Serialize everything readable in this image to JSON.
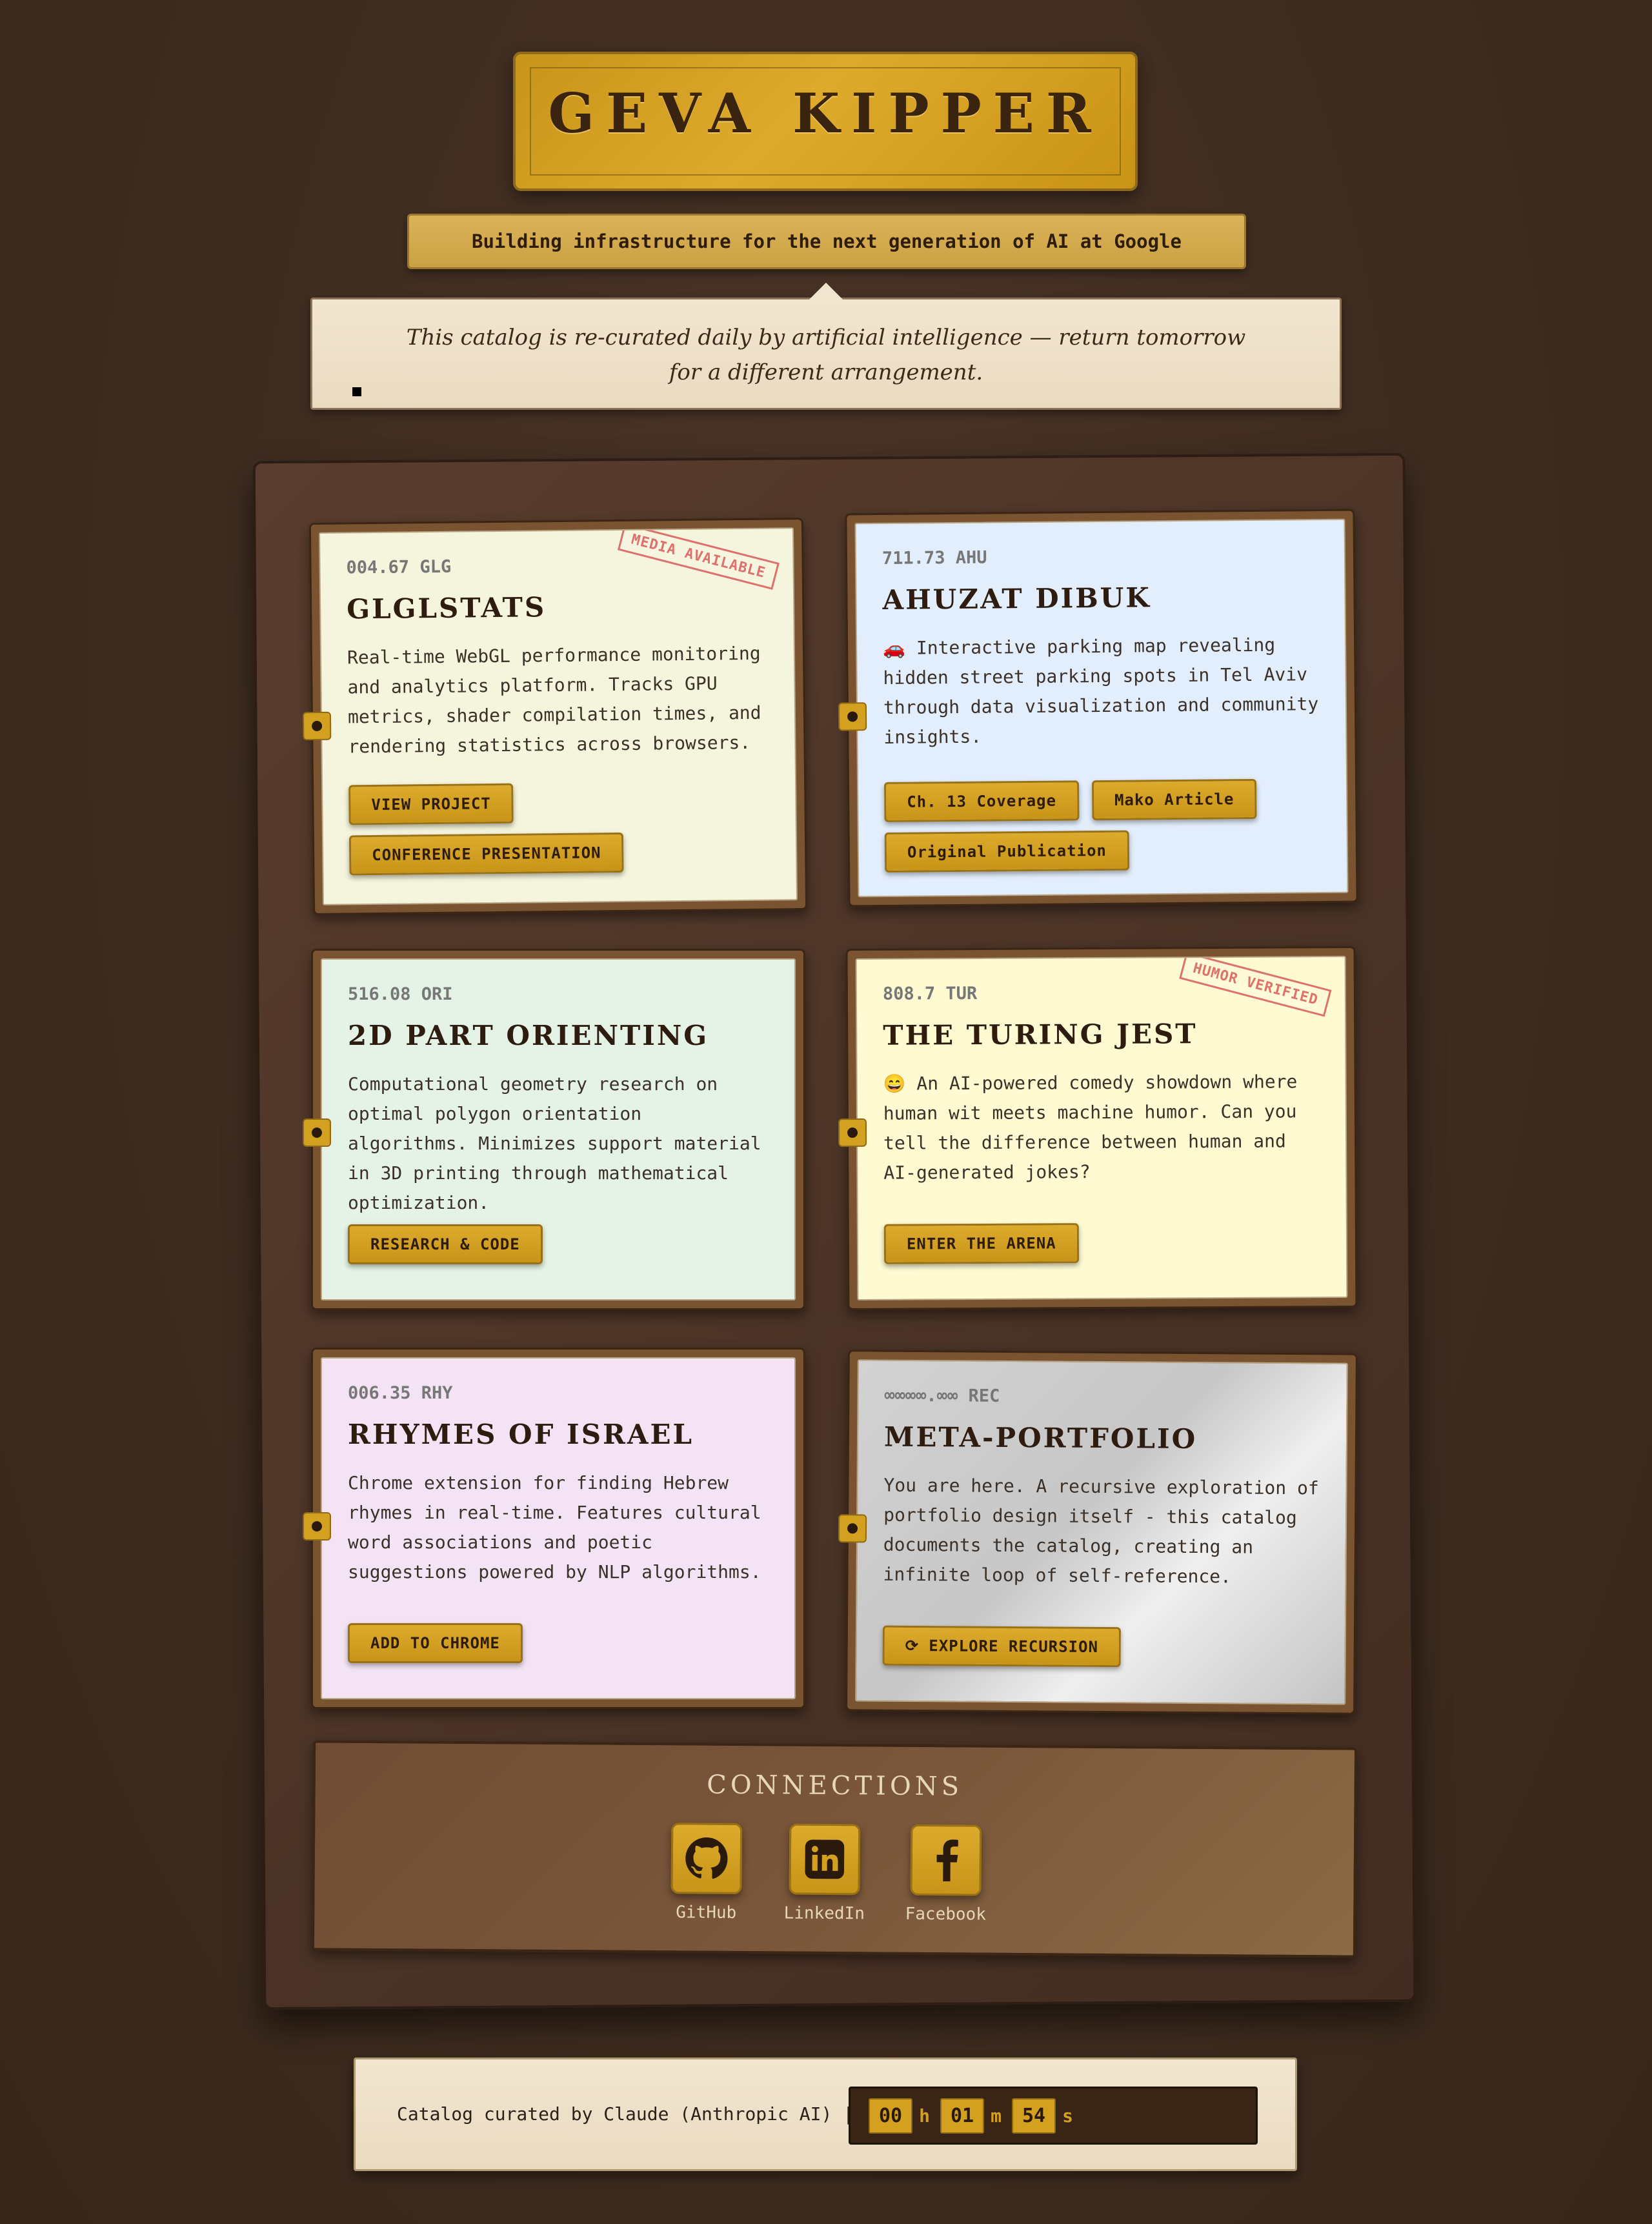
{
  "header": {
    "name": "GEVA KIPPER",
    "tagline": "Building infrastructure for the next generation of AI at Google",
    "notice": "This catalog is re-curated daily by artificial intelligence — return tomorrow for a different arrangement."
  },
  "cards": [
    {
      "code": "004.67 GLG",
      "title": "GLGLSTATS",
      "description": "Real-time WebGL performance monitoring and analytics platform. Tracks GPU metrics, shader compilation times, and rendering statistics across browsers.",
      "stamp": "MEDIA AVAILABLE",
      "buttons": [
        "VIEW PROJECT",
        "CONFERENCE PRESENTATION"
      ],
      "color": "#f5f4dc"
    },
    {
      "code": "711.73 AHU",
      "title": "AHUZAT DIBUK",
      "description": "🚗 Interactive parking map revealing hidden street parking spots in Tel Aviv through data visualization and community insights.",
      "buttons": [
        "Ch. 13 Coverage",
        "Mako Article",
        "Original Publication"
      ],
      "color": "#e3eefc"
    },
    {
      "code": "516.08 ORI",
      "title": "2D PART ORIENTING",
      "description": "Computational geometry research on optimal polygon orientation algorithms. Minimizes support material in 3D printing through mathematical optimization.",
      "buttons": [
        "RESEARCH & CODE"
      ],
      "color": "#e4f3e6"
    },
    {
      "code": "808.7 TUR",
      "title": "THE TURING JEST",
      "description": "😄 An AI-powered comedy showdown where human wit meets machine humor. Can you tell the difference between human and AI-generated jokes?",
      "stamp": "HUMOR VERIFIED",
      "buttons": [
        "ENTER THE ARENA"
      ],
      "color": "#fefad2"
    },
    {
      "code": "006.35 RHY",
      "title": "RHYMES OF ISRAEL",
      "description": "Chrome extension for finding Hebrew rhymes in real-time. Features cultural word associations and poetic suggestions powered by NLP algorithms.",
      "buttons": [
        "ADD TO CHROME"
      ],
      "color": "#f3e3f4"
    },
    {
      "code": "∞∞∞∞.∞∞ REC",
      "title": "META-PORTFOLIO",
      "description": "You are here. A recursive exploration of portfolio design itself - this catalog documents the catalog, creating an infinite loop of self-reference.",
      "buttons": [
        "⟳ EXPLORE RECURSION"
      ],
      "color": "#d9d9d9"
    }
  ],
  "connections": {
    "title": "CONNECTIONS",
    "links": [
      {
        "label": "GitHub",
        "icon": "github-icon"
      },
      {
        "label": "LinkedIn",
        "icon": "linkedin-icon"
      },
      {
        "label": "Facebook",
        "icon": "facebook-icon"
      }
    ]
  },
  "footer": {
    "text": "Catalog curated by Claude (Anthropic AI) |",
    "timer": {
      "hours": "00",
      "h": "h",
      "minutes": "01",
      "m": "m",
      "seconds": "54",
      "s": "s"
    }
  }
}
